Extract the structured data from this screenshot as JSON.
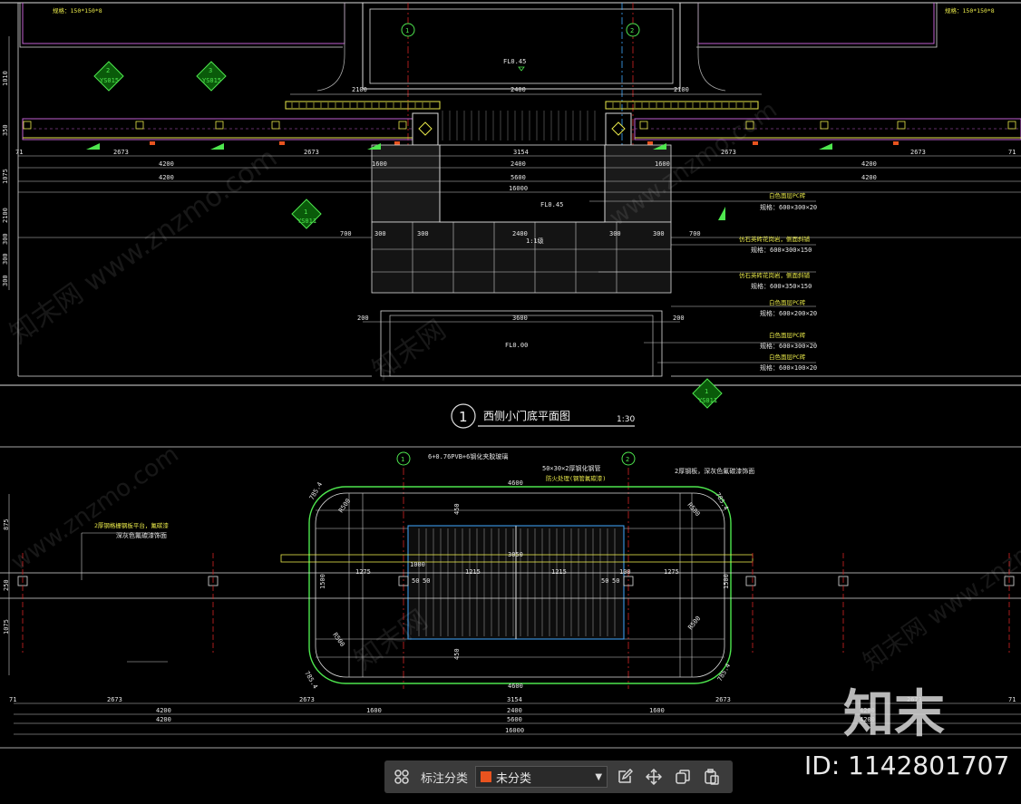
{
  "drawing": {
    "top": {
      "spec_left": "规格：150*150*8",
      "spec_right": "规格：150*150*8",
      "grid_1": "1",
      "grid_2": "2",
      "fl_top": "FL0.45",
      "fl_mid": "FL0.45",
      "fl_bottom": "FL0.00",
      "step": "1:1级",
      "dims_top": [
        "2100",
        "2400",
        "2100"
      ],
      "dims_row1": [
        "71",
        "2673",
        "2673",
        "3154",
        "2673",
        "2673",
        "71"
      ],
      "dims_row2": [
        "4200",
        "2400",
        "4200"
      ],
      "dims_row3": [
        "4200",
        "5600",
        "4200"
      ],
      "dims_total": "16000",
      "dims_1600": [
        "1600",
        "1600"
      ],
      "dims_row4": [
        "700",
        "300",
        "300",
        "2400",
        "300",
        "300",
        "700"
      ],
      "dims_row5": [
        "200",
        "3600",
        "200"
      ],
      "left_dims": [
        "1010",
        "350",
        "1075",
        "2100",
        "300",
        "300",
        "300"
      ],
      "section_marks": [
        {
          "num": "2",
          "ref": "YS015"
        },
        {
          "num": "3",
          "ref": "YS015"
        },
        {
          "num": "1",
          "ref": "YS011"
        },
        {
          "num": "1",
          "ref": "YS011"
        }
      ],
      "notes": [
        {
          "title": "白色面层PC砖",
          "spec": "规格：600×300×20"
        },
        {
          "title": "仿石英砖花岗岩，侧面斜铺",
          "spec": "规格：600×300×150"
        },
        {
          "title": "仿石英砖花岗岩，侧面斜铺",
          "spec": "规格：600×350×150"
        },
        {
          "title": "白色面层PC砖",
          "spec": "规格：600×200×20"
        },
        {
          "title": "白色面层PC砖",
          "spec": "规格：600×300×20"
        },
        {
          "title": "白色面层PC砖",
          "spec": "规格：600×100×20"
        }
      ]
    },
    "title_block": {
      "number": "1",
      "name": "西侧小门底平面图",
      "scale": "1:30"
    },
    "bottom": {
      "grid_1": "1",
      "grid_2": "2",
      "note_glass": "6+0.76PVB+6钢化夹胶玻璃",
      "note_steel": "50×30×2厚钢化钢管",
      "note_steel2": "防火处理(钢管氟碳漆)",
      "note_right": "2厚钢板，深灰色氟碳漆饰面",
      "note_left": "2厚钢格栅钢板平台，氟碳漆",
      "note_left2": "深灰色氟碳漆饰面",
      "dim_4600_top": "4600",
      "dim_4600_bot": "4600",
      "dim_3050": "3050",
      "dims_mid": [
        "1275",
        "1215",
        "1215",
        "1275"
      ],
      "dims_small": [
        "1000",
        "100",
        "50",
        "50",
        "50",
        "50"
      ],
      "dims_vert": [
        "450",
        "450"
      ],
      "radius": [
        "R500",
        "R500",
        "R500",
        "R500"
      ],
      "corner": [
        "785.4",
        "785.4",
        "785.4",
        "785.4"
      ],
      "side_dims": [
        "1500",
        "1500"
      ],
      "left_dims": [
        "875",
        "250",
        "1075"
      ],
      "dims_row1": [
        "71",
        "2673",
        "2673",
        "3154",
        "2673",
        "2673",
        "71"
      ],
      "dims_row2": [
        "4200",
        "1600",
        "2400",
        "1600",
        "4200"
      ],
      "dims_row3": [
        "4200",
        "5600",
        "4200"
      ],
      "dims_total": "16000"
    },
    "watermarks": [
      "www.znzmo.com",
      "知末网",
      "知末网 www.znzmo.com"
    ]
  },
  "toolbar": {
    "grid_icon": "grid-icon",
    "label": "标注分类",
    "selected": "未分类",
    "swatch_color": "#e8531f",
    "tools": [
      "edit-icon",
      "move-icon",
      "copy-icon",
      "paste-icon"
    ]
  },
  "watermark": {
    "logo_text": "知末",
    "id_text": "ID: 1142801707"
  },
  "colors": {
    "background": "#000000",
    "green": "#4ee64e",
    "white_line": "#dcdcdc",
    "red_grid": "#d22222",
    "cyan_grid": "#3fa8ff",
    "yellow": "#e8e84a",
    "magenta": "#c060d0"
  }
}
